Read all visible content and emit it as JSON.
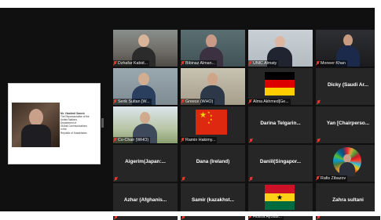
{
  "shared_slide": {
    "speaker_name": "Mr. Vlastimil Samek",
    "speaker_desc": [
      "The Representative of the",
      "United Nations",
      "Department of",
      "Global Communications",
      "in the",
      "Republic of Kazakhstan"
    ]
  },
  "participants": [
    {
      "name": "Dzhafar Kabid...",
      "kind": "video"
    },
    {
      "name": "Bibinaz Alman...",
      "kind": "video"
    },
    {
      "name": "UNIC Almaty",
      "kind": "video",
      "active": true
    },
    {
      "name": "Moneer Khan",
      "kind": "video"
    },
    {
      "name": "Serik Sultan [W...",
      "kind": "video"
    },
    {
      "name": "Greece (WHO)",
      "kind": "video"
    },
    {
      "name": "Alma Akhmed[Ge...",
      "kind": "flag",
      "flag": "germany"
    },
    {
      "name": "Dicky (Saudi Ar...",
      "kind": "name"
    },
    {
      "name": "Co-Chair (WHO)",
      "kind": "video"
    },
    {
      "name": "Ramin Hakimy...",
      "kind": "flag",
      "flag": "china"
    },
    {
      "name": "Darina Telgarin...",
      "kind": "name"
    },
    {
      "name": "Yan [Chairperso...",
      "kind": "name"
    },
    {
      "name": "Aigerim(Japan:...",
      "kind": "name"
    },
    {
      "name": "Dana (Ireland)",
      "kind": "name"
    },
    {
      "name": "Daniil(Singapor...",
      "kind": "name"
    },
    {
      "name": "Rafis Zibazov",
      "kind": "video"
    },
    {
      "name": "Azhar (Afghanis...",
      "kind": "name"
    },
    {
      "name": "Samir (kazakhst...",
      "kind": "name"
    },
    {
      "name": "Husna Ayoubi...",
      "kind": "flag",
      "flag": "ghana"
    },
    {
      "name": "Zahra sultani",
      "kind": "name"
    }
  ],
  "colors": {
    "active_border": "#d8de3a",
    "muted_mic": "#e03a2e",
    "tile_bg": "#262626",
    "app_bg": "#101010"
  }
}
